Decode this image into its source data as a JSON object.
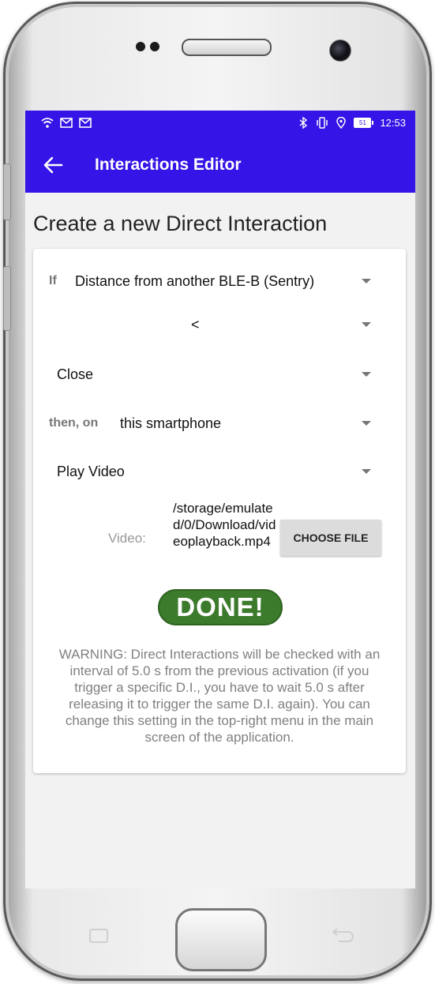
{
  "status_bar": {
    "time": "12:53",
    "battery": "51",
    "left_icons": [
      "wifi-icon",
      "gmail-icon",
      "gmail-icon"
    ],
    "right_icons": [
      "bluetooth-icon",
      "vibrate-icon",
      "location-icon",
      "battery-icon"
    ]
  },
  "app_bar": {
    "title": "Interactions Editor",
    "back_icon": "arrow-back-icon",
    "color": "#3414e6"
  },
  "page": {
    "heading": "Create a new Direct Interaction"
  },
  "form": {
    "condition": {
      "prefix": "If",
      "value": "Distance from another BLE-B (Sentry)"
    },
    "operator": {
      "value": "<"
    },
    "distance": {
      "value": "Close"
    },
    "target": {
      "prefix": "then, on",
      "value": "this smartphone"
    },
    "action": {
      "value": "Play Video"
    },
    "video": {
      "label": "Video:",
      "path": "/storage/emulated/0/Download/videoplayback.mp4",
      "choose_label": "CHOOSE FILE"
    },
    "done_label": "DONE!",
    "done_color": "#3c7a2c",
    "warning": "WARNING: Direct Interactions will be checked with an interval of 5.0 s from the previous activation (if you trigger a specific D.I., you have to wait 5.0 s after releasing it to trigger the same D.I. again). You can change this setting in the top-right menu in the main screen of the application."
  }
}
